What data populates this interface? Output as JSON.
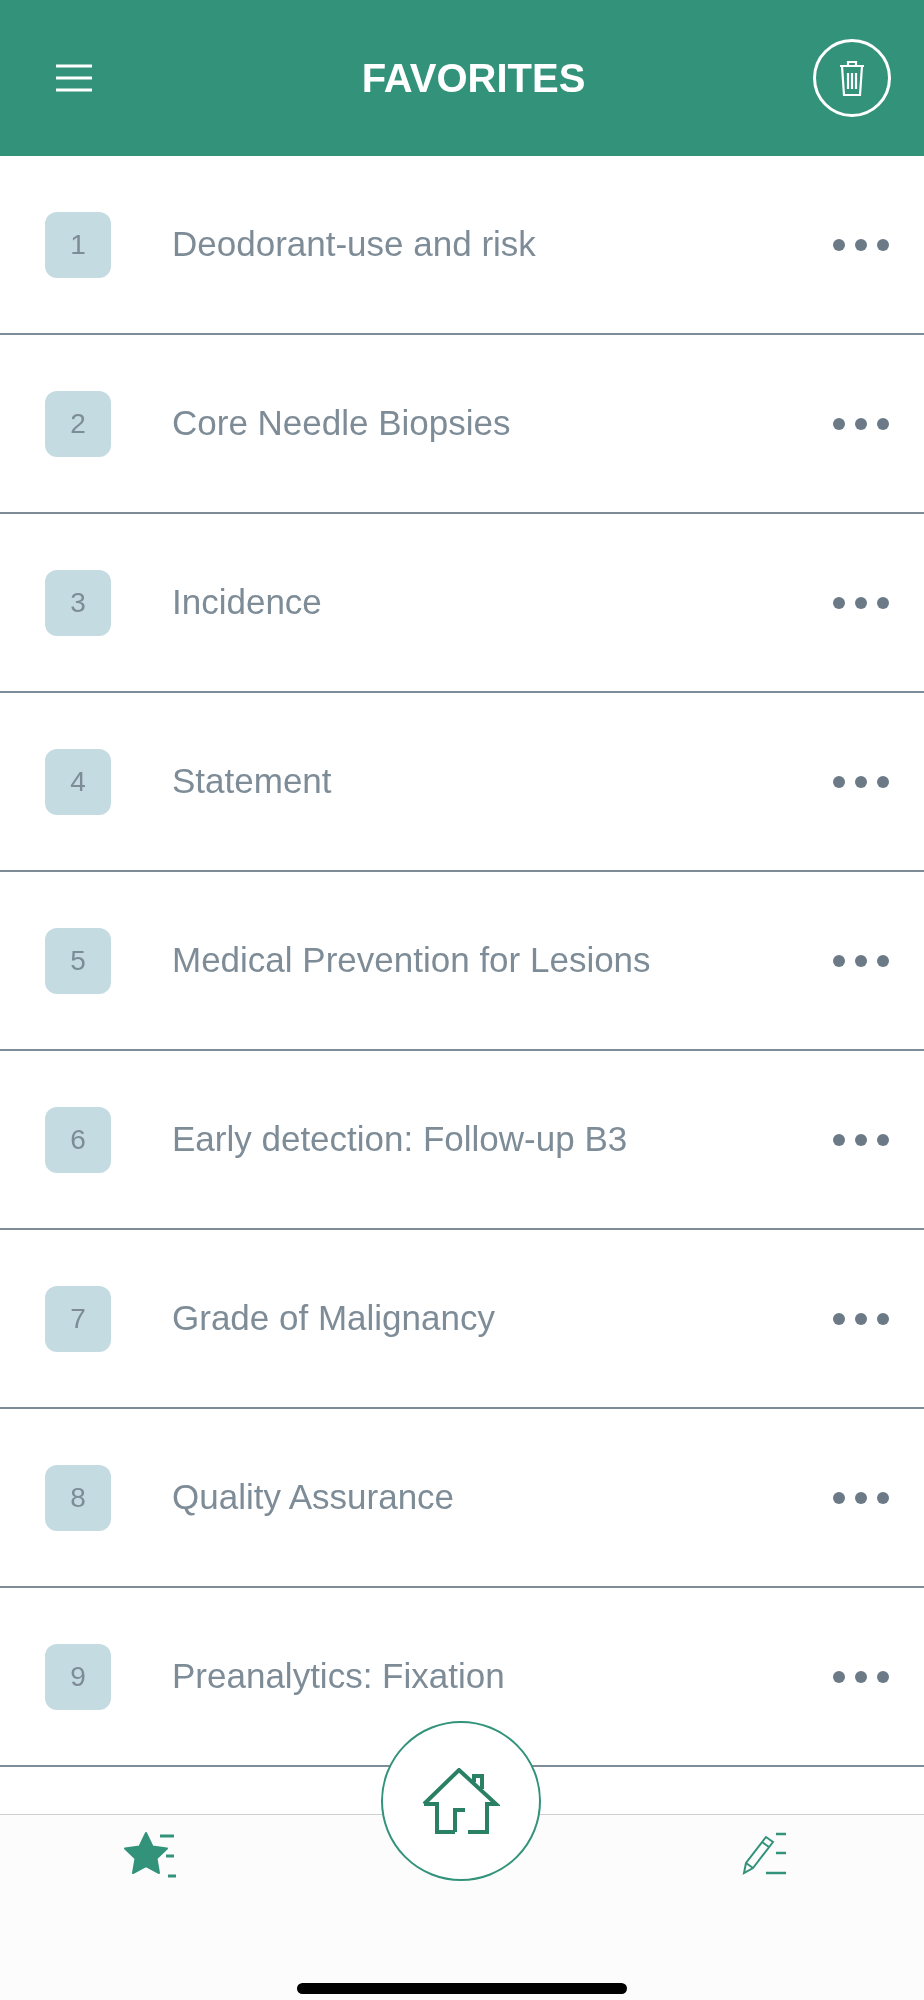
{
  "header": {
    "title": "FAVORITES"
  },
  "rows": [
    {
      "number": "1",
      "title": "Deodorant-use and risk"
    },
    {
      "number": "2",
      "title": "Core Needle Biopsies"
    },
    {
      "number": "3",
      "title": "Incidence"
    },
    {
      "number": "4",
      "title": "Statement"
    },
    {
      "number": "5",
      "title": "Medical Prevention for Lesions"
    },
    {
      "number": "6",
      "title": "Early detection: Follow-up B3"
    },
    {
      "number": "7",
      "title": "Grade of Malignancy"
    },
    {
      "number": "8",
      "title": "Quality Assurance"
    },
    {
      "number": "9",
      "title": "Preanalytics: Fixation"
    }
  ],
  "nav": [
    {
      "kind": "favorites"
    },
    {
      "kind": "home"
    },
    {
      "kind": "notes"
    }
  ]
}
